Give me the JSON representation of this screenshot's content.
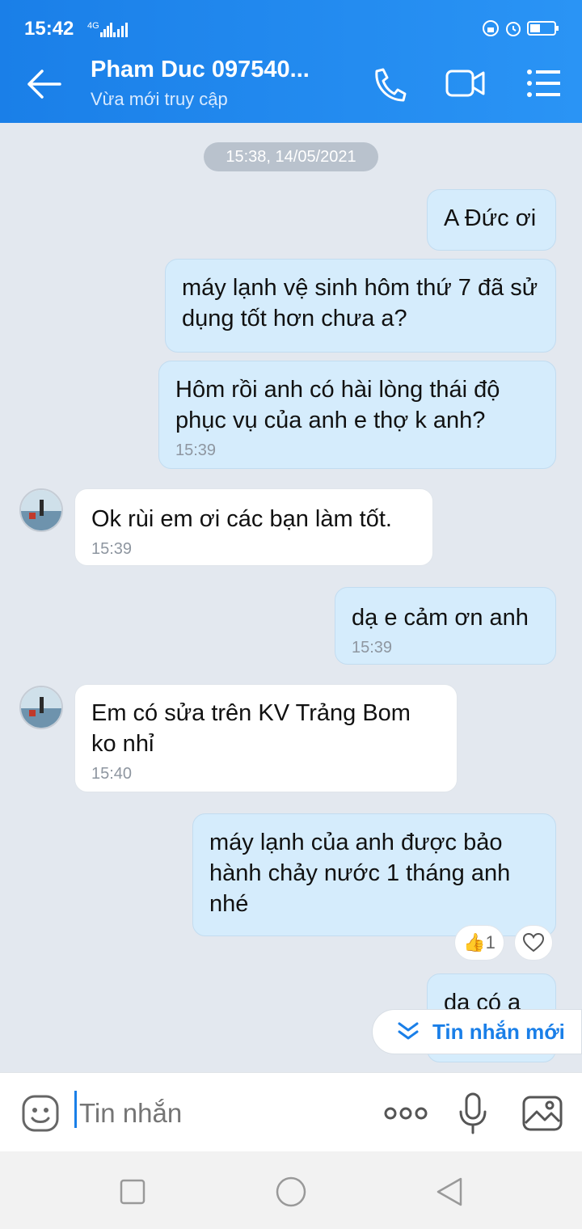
{
  "status_bar": {
    "time": "15:42",
    "network": "4G"
  },
  "header": {
    "contact_name": "Pham Duc 097540...",
    "presence": "Vừa mới truy cập",
    "icons": [
      "back-arrow-icon",
      "phone-icon",
      "video-call-icon",
      "menu-list-icon"
    ]
  },
  "chat": {
    "date_separator": "15:38, 14/05/2021",
    "messages": [
      {
        "direction": "out",
        "text": "A Đức ơi"
      },
      {
        "direction": "out",
        "text": "máy lạnh vệ sinh hôm thứ 7 đã sử dụng tốt hơn chưa a?"
      },
      {
        "direction": "out",
        "text": "Hôm rồi anh có hài lòng thái độ phục vụ của anh e thợ k anh?",
        "time": "15:39"
      },
      {
        "direction": "in",
        "text": "Ok rùi em ơi các bạn làm tốt.",
        "time": "15:39"
      },
      {
        "direction": "out",
        "text": "dạ e cảm ơn anh",
        "time": "15:39"
      },
      {
        "direction": "in",
        "text": "Em có sửa trên KV Trảng Bom ko nhỉ",
        "time": "15:40"
      },
      {
        "direction": "out",
        "text": "máy lạnh của anh được bảo hành chảy nước 1 tháng anh nhé",
        "reaction_count": "1"
      },
      {
        "direction": "out",
        "text": "dạ có a"
      }
    ]
  },
  "new_messages_button": "Tin nhắn mới",
  "composer": {
    "placeholder": "Tin nhắn"
  },
  "colors": {
    "accent": "#1a7fe8",
    "outgoing_bubble": "#d5ecfc",
    "chat_background": "#e3e8ef"
  }
}
